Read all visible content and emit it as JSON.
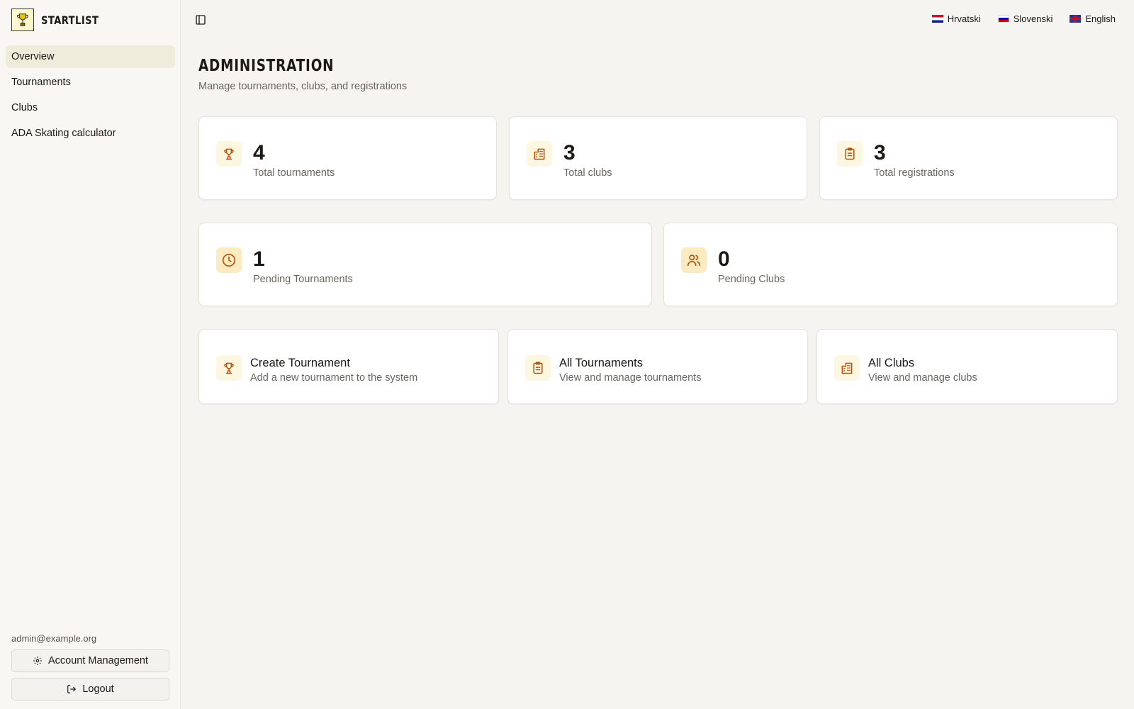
{
  "app": {
    "name": "STARTLIST"
  },
  "sidebar": {
    "items": [
      {
        "label": "Overview",
        "active": true
      },
      {
        "label": "Tournaments"
      },
      {
        "label": "Clubs"
      },
      {
        "label": "ADA Skating calculator"
      }
    ],
    "user_email": "admin@example.org",
    "account_label": "Account Management",
    "logout_label": "Logout"
  },
  "languages": [
    {
      "label": "Hrvatski",
      "flag": "hr-flag-icon"
    },
    {
      "label": "Slovenski",
      "flag": "si-flag-icon"
    },
    {
      "label": "English",
      "flag": "gb-flag-icon"
    }
  ],
  "page": {
    "title": "ADMINISTRATION",
    "subtitle": "Manage tournaments, clubs, and registrations"
  },
  "stats": [
    {
      "value": "4",
      "label": "Total tournaments",
      "icon": "trophy-icon"
    },
    {
      "value": "3",
      "label": "Total clubs",
      "icon": "building-icon"
    },
    {
      "value": "3",
      "label": "Total registrations",
      "icon": "clipboard-icon"
    },
    {
      "value": "1",
      "label": "Pending Tournaments",
      "icon": "clock-icon"
    },
    {
      "value": "0",
      "label": "Pending Clubs",
      "icon": "users-icon"
    }
  ],
  "actions": [
    {
      "title": "Create Tournament",
      "desc": "Add a new tournament to the system",
      "icon": "trophy-icon"
    },
    {
      "title": "All Tournaments",
      "desc": "View and manage tournaments",
      "icon": "clipboard-icon"
    },
    {
      "title": "All Clubs",
      "desc": "View and manage clubs",
      "icon": "building-icon"
    }
  ],
  "colors": {
    "accent_icon": "#b45309",
    "active_nav": "#f0ecdc",
    "background": "#f5f4f0"
  }
}
